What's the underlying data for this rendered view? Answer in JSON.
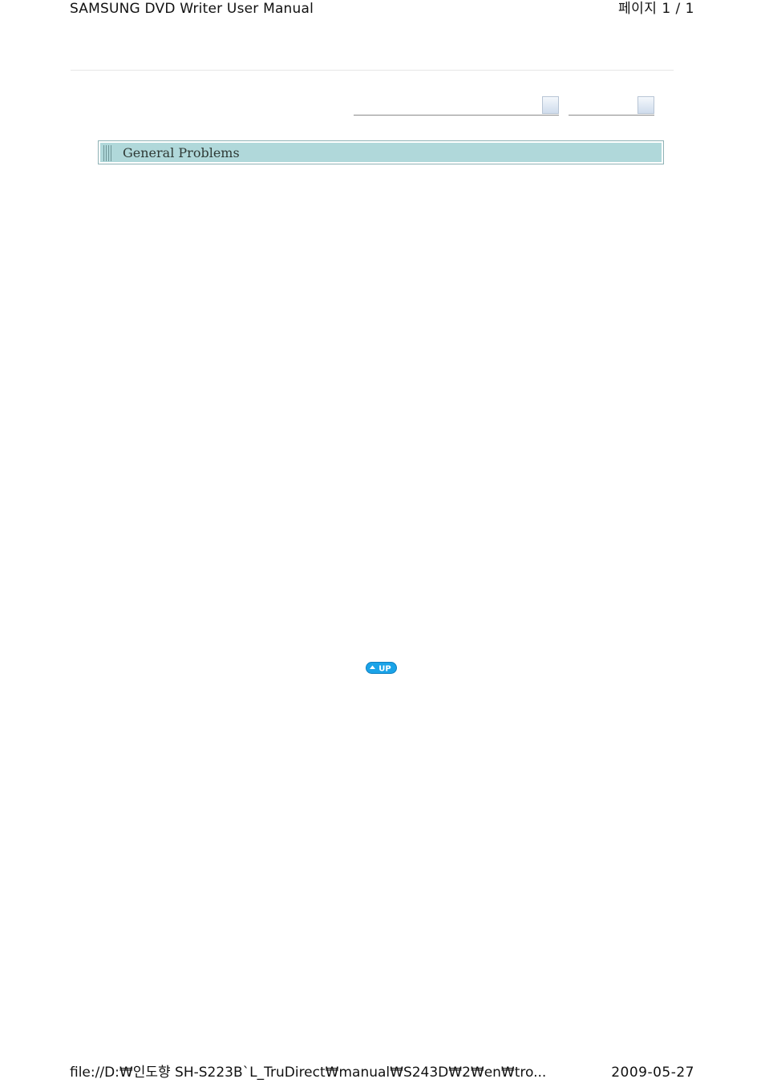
{
  "print_header": {
    "title": "SAMSUNG DVD Writer User Manual",
    "page_indicator": "페이지 1 / 1"
  },
  "navigation": {
    "selects": [
      {
        "value": "",
        "icon": "dropdown-arrow-icon"
      },
      {
        "value": "",
        "icon": "dropdown-arrow-icon"
      }
    ]
  },
  "section": {
    "title": "General Problems",
    "bar_color": "#b0d8da",
    "border_color": "#8fb2b5"
  },
  "up_button": {
    "label": "UP",
    "icon": "up-arrow-icon",
    "color": "#1aa3e8"
  },
  "print_footer": {
    "path": "file://D:₩인도향 SH-S223B`L_TruDirect₩manual₩S243D₩2₩en₩tro...",
    "date": "2009-05-27"
  }
}
